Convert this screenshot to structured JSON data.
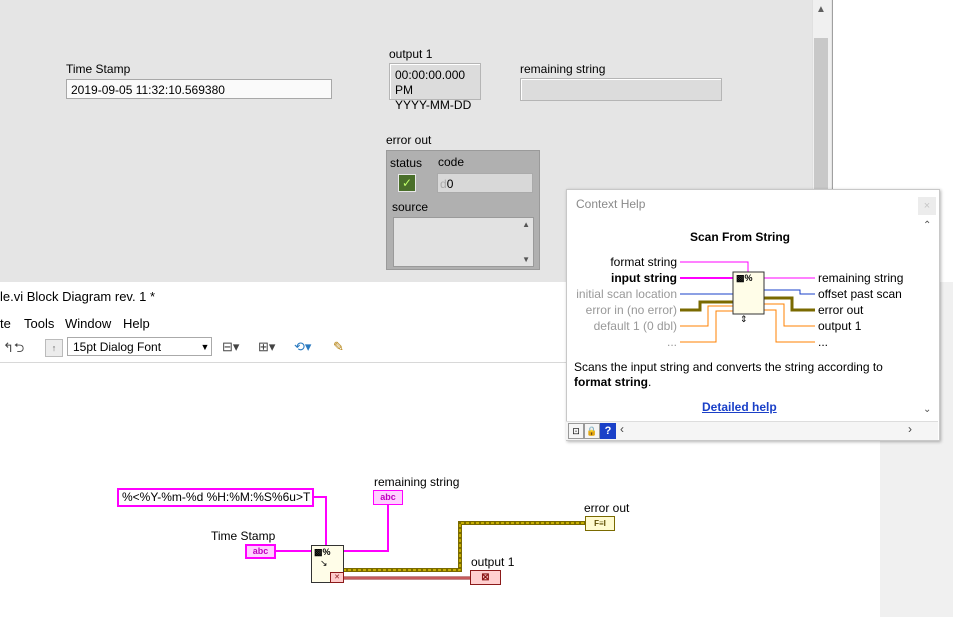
{
  "front_panel": {
    "timestamp": {
      "label": "Time Stamp",
      "value": "2019-09-05  11:32:10.569380"
    },
    "output1": {
      "label": "output 1",
      "line1": "00:00:00.000 PM",
      "line2": "YYYY-MM-DD"
    },
    "remaining_string": {
      "label": "remaining string",
      "value": ""
    },
    "error_out": {
      "label": "error out",
      "status_label": "status",
      "status_glyph": "✓",
      "code_label": "code",
      "code_radix": "d",
      "code_value": "0",
      "source_label": "source"
    }
  },
  "block_diagram": {
    "title": "le.vi Block Diagram rev. 1 *",
    "menu": [
      "te",
      "Tools",
      "Window",
      "Help"
    ],
    "font_select": "15pt Dialog Font",
    "toolbar_icons": [
      "undo-redo-icon",
      "align-objects-icon",
      "distribute-objects-icon",
      "reorder-icon",
      "cleanup-diagram-icon"
    ],
    "format_constant": "%<%Y-%m-%d  %H:%M:%S%6u>T",
    "labels": {
      "remaining_string": "remaining string",
      "time_stamp": "Time Stamp",
      "error_out": "error out",
      "output1": "output 1"
    },
    "terminal_glyphs": {
      "string": "abc",
      "error": "F≡I",
      "timestamp": "⊠"
    }
  },
  "context_help": {
    "title": "Context Help",
    "close_glyph": "×",
    "function_name": "Scan From String",
    "left_terminals": [
      {
        "name": "format string",
        "style": "normal"
      },
      {
        "name": "input string",
        "style": "bold"
      },
      {
        "name": "initial scan location",
        "style": "dim"
      },
      {
        "name": "error in (no error)",
        "style": "dim"
      },
      {
        "name": "default 1 (0 dbl)",
        "style": "dim"
      },
      {
        "name": "...",
        "style": "dim"
      }
    ],
    "right_terminals": [
      "remaining string",
      "offset past scan",
      "error out",
      "output 1",
      "..."
    ],
    "description_part1": "Scans the input string and converts the string according to ",
    "description_bold": "format string",
    "description_part2": ".",
    "detailed_help": "Detailed help"
  },
  "colors": {
    "string_wire": "#ff00ff",
    "error_wire": "#7a6a00",
    "numeric_wire": "#ff8000",
    "timestamp_wire": "#8b1a1a",
    "panel_bg": "#e5e5e5",
    "link": "#1a40c8"
  }
}
